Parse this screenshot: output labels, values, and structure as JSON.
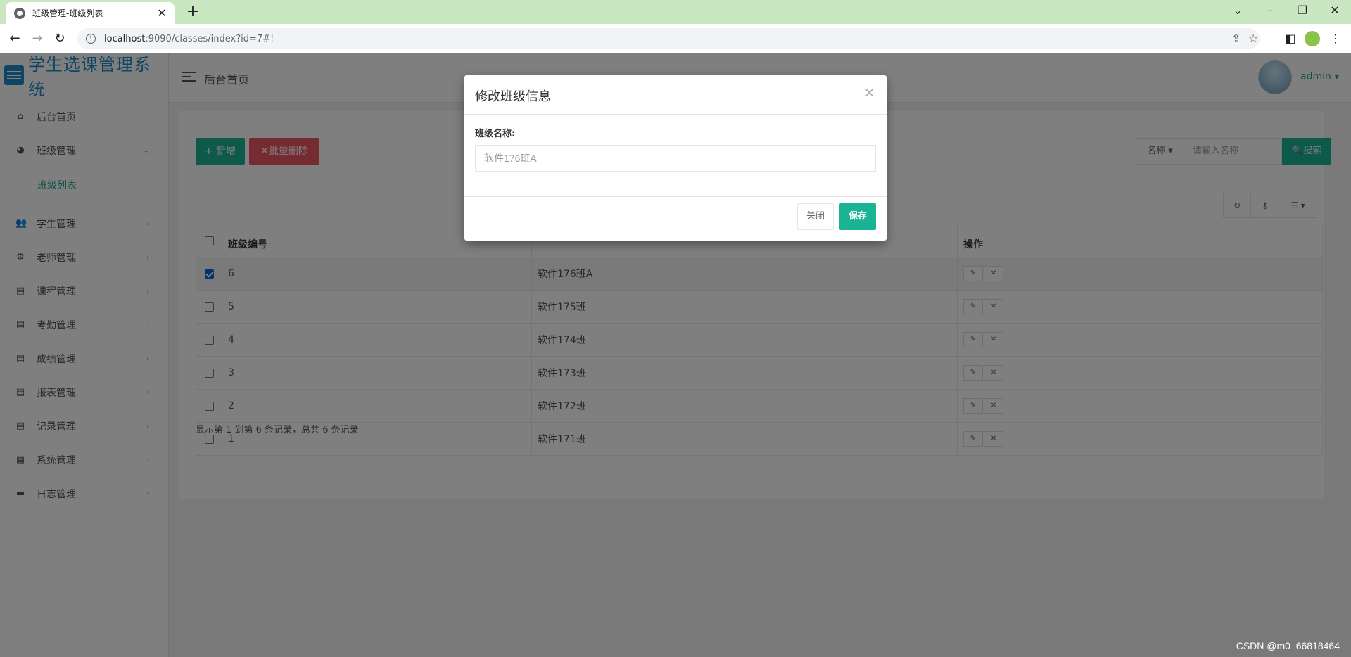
{
  "browser": {
    "tab_title": "班级管理-班级列表",
    "tab_close": "✕",
    "new_tab": "+",
    "url_host": "localhost",
    "url_rest": ":9090/classes/index?id=7#!"
  },
  "app": {
    "brand": "学生选课管理系统",
    "top_title": "后台首页",
    "user": "admin ▾"
  },
  "sidebar": {
    "items": [
      {
        "label": "后台首页",
        "icon": "home-icon"
      },
      {
        "label": "班级管理",
        "icon": "palette-icon"
      },
      {
        "label": "学生管理",
        "icon": "users-icon"
      },
      {
        "label": "老师管理",
        "icon": "user-gear-icon"
      },
      {
        "label": "课程管理",
        "icon": "file-icon"
      },
      {
        "label": "考勤管理",
        "icon": "file-text-icon"
      },
      {
        "label": "成绩管理",
        "icon": "file-check-icon"
      },
      {
        "label": "报表管理",
        "icon": "file-chart-icon"
      },
      {
        "label": "记录管理",
        "icon": "file-lines-icon"
      },
      {
        "label": "系统管理",
        "icon": "grid-icon"
      },
      {
        "label": "日志管理",
        "icon": "book-icon"
      }
    ],
    "subitem": "班级列表"
  },
  "toolbar": {
    "add_label": "+ 新增",
    "batch_delete_label": "✕批量删除",
    "search_field": "名称 ▾",
    "search_placeholder": "请输入名称",
    "search_label": "🔍搜索"
  },
  "table": {
    "headers": {
      "id": "班级编号",
      "name": "",
      "ops": "操作"
    },
    "rows": [
      {
        "id": "6",
        "name": "软件176班A",
        "checked": true
      },
      {
        "id": "5",
        "name": "软件175班",
        "checked": false
      },
      {
        "id": "4",
        "name": "软件174班",
        "checked": false
      },
      {
        "id": "3",
        "name": "软件173班",
        "checked": false
      },
      {
        "id": "2",
        "name": "软件172班",
        "checked": false
      },
      {
        "id": "1",
        "name": "软件171班",
        "checked": false
      }
    ],
    "edit_glyph": "✎",
    "delete_glyph": "✕"
  },
  "pager": {
    "info": "显示第 1 到第 6 条记录，总共 6 条记录"
  },
  "modal": {
    "title": "修改班级信息",
    "close_glyph": "×",
    "field_label": "班级名称:",
    "field_value": "软件176班A",
    "close_label": "关闭",
    "save_label": "保存"
  },
  "watermark": "CSDN @m0_66818464",
  "colors": {
    "accent": "#1ab394",
    "danger": "#ed5565",
    "brand": "#1e88c8",
    "tabbar": "#c9e8c1"
  }
}
